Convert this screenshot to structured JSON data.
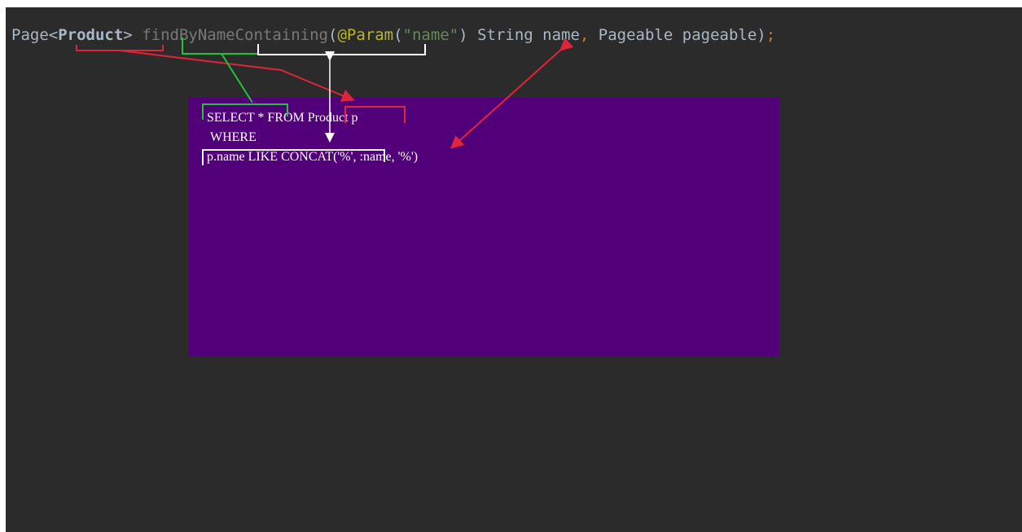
{
  "code": {
    "page": "Page",
    "lt": "<",
    "product": "Product",
    "gt": ">",
    "space1": " ",
    "method": "findByNameContaining",
    "open_paren": "(",
    "annotation": "@Param",
    "annot_open": "(",
    "string_literal": "\"name\"",
    "annot_close": ")",
    "param1": " String name",
    "comma": ",",
    "param2": " Pageable pageable)",
    "semicolon": ";"
  },
  "sql": {
    "line1_select": "SELECT * ",
    "line1_from": "FROM ",
    "line1_product": "Product",
    "line1_alias": " p",
    "line2": "WHERE",
    "line3_a": "p.name LIKE CONCAT",
    "line3_b": "('%', :name, '%')"
  },
  "colors": {
    "editor_bg": "#2b2b2b",
    "sql_bg": "#52007a",
    "annotation_red": "#e0243a",
    "annotation_green": "#22c33a",
    "annotation_white": "#ffffff"
  }
}
